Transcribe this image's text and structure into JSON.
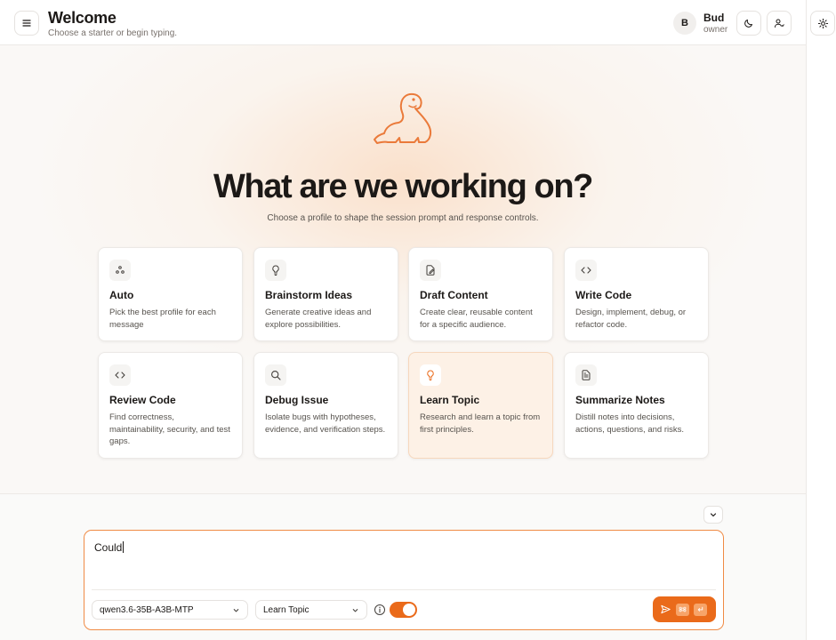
{
  "header": {
    "title": "Welcome",
    "subtitle": "Choose a starter or begin typing.",
    "user": {
      "initial": "B",
      "name": "Bud",
      "role": "owner"
    }
  },
  "hero": {
    "heading": "What are we working on?",
    "subheading": "Choose a profile to shape the session prompt and response controls."
  },
  "profiles": [
    {
      "title": "Auto",
      "description": "Pick the best profile for each message",
      "icon": "sparkles-icon"
    },
    {
      "title": "Brainstorm Ideas",
      "description": "Generate creative ideas and explore possibilities.",
      "icon": "lightbulb-icon"
    },
    {
      "title": "Draft Content",
      "description": "Create clear, reusable content for a specific audience.",
      "icon": "document-edit-icon"
    },
    {
      "title": "Write Code",
      "description": "Design, implement, debug, or refactor code.",
      "icon": "code-icon"
    },
    {
      "title": "Review Code",
      "description": "Find correctness, maintainability, security, and test gaps.",
      "icon": "code-icon"
    },
    {
      "title": "Debug Issue",
      "description": "Isolate bugs with hypotheses, evidence, and verification steps.",
      "icon": "search-icon"
    },
    {
      "title": "Learn Topic",
      "description": "Research and learn a topic from first principles.",
      "icon": "lightbulb-icon",
      "active": true
    },
    {
      "title": "Summarize Notes",
      "description": "Distill notes into decisions, actions, questions, and risks.",
      "icon": "document-text-icon"
    }
  ],
  "composer": {
    "input_value": "Could",
    "model_select": "qwen3.6-35B-A3B-MTP",
    "profile_select": "Learn Topic",
    "toggle_on": true
  },
  "colors": {
    "accent": "#ea6a1a",
    "accent_light": "#fdf1e6",
    "text": "#1c1917",
    "muted": "#57534e"
  }
}
